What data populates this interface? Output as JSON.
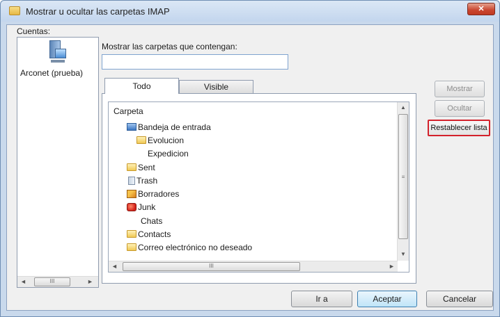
{
  "window": {
    "title": "Mostrar u ocultar las carpetas IMAP",
    "close_glyph": "✕"
  },
  "accounts": {
    "label": "Cuentas:",
    "items": [
      {
        "label": "Arconet (prueba)",
        "icon": "server-computer-icon",
        "selected": true
      }
    ],
    "scroll_thumb": "III"
  },
  "filter": {
    "label": "Mostrar las carpetas que contengan:",
    "value": ""
  },
  "tabs": [
    {
      "label": "Todo",
      "active": true
    },
    {
      "label": "Visible",
      "active": false
    }
  ],
  "folders": {
    "column_header": "Carpeta",
    "items": [
      {
        "label": "Bandeja de entrada",
        "icon": "inbox-icon",
        "level": 1
      },
      {
        "label": "Evolucion",
        "icon": "folder-icon",
        "level": 2
      },
      {
        "label": "Expedicion",
        "icon": "none",
        "level": 2
      },
      {
        "label": "Sent",
        "icon": "folder-icon",
        "level": 1
      },
      {
        "label": "Trash",
        "icon": "trash-icon",
        "level": 1
      },
      {
        "label": "Borradores",
        "icon": "drafts-icon",
        "level": 1
      },
      {
        "label": "Junk",
        "icon": "junk-icon",
        "level": 1
      },
      {
        "label": "Chats",
        "icon": "none",
        "level": 1
      },
      {
        "label": "Contacts",
        "icon": "folder-icon",
        "level": 1
      },
      {
        "label": "Correo electrónico no deseado",
        "icon": "folder-icon",
        "level": 1
      }
    ],
    "scroll_thumb": "III",
    "vscroll_thumb": "≡"
  },
  "side_buttons": {
    "show": "Mostrar",
    "hide": "Ocultar",
    "reset": "Restablecer lista"
  },
  "footer": {
    "goto": "Ir a",
    "ok": "Aceptar",
    "cancel": "Cancelar"
  },
  "colors": {
    "highlight_border": "#d3212b",
    "default_button": "#3c7fb1"
  }
}
